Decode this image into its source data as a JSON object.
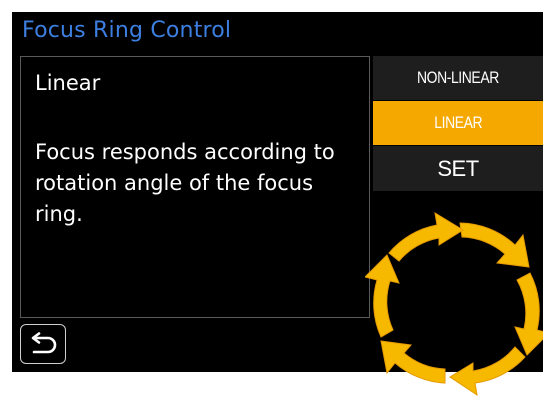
{
  "title": "Focus Ring Control",
  "description": {
    "heading": "Linear",
    "body": "Focus responds according to rotation angle of the focus ring."
  },
  "options": [
    {
      "label": "NON-LINEAR",
      "selected": false
    },
    {
      "label": "LINEAR",
      "selected": true
    },
    {
      "label": "SET",
      "selected": false
    }
  ],
  "back_icon": "return-arrow-icon",
  "ring_icon": "focus-ring-rotation-icon",
  "colors": {
    "title": "#3d7fe0",
    "selected": "#f5a800",
    "option_bg": "#1e1e1e",
    "ring": "#f5b700"
  }
}
